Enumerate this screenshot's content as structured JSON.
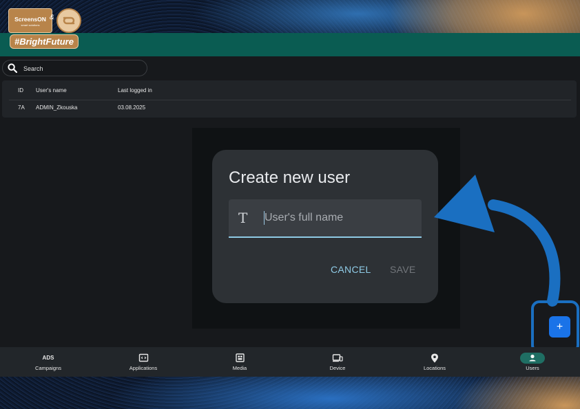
{
  "branding": {
    "brand_name": "ScreensON",
    "brand_sub": "smart solutions",
    "ampersand": "&",
    "hashtag": "#BrightFuture"
  },
  "search": {
    "placeholder": "Search",
    "icon": "search-icon"
  },
  "table": {
    "columns": [
      "ID",
      "User's name",
      "Last logged in"
    ],
    "rows": [
      {
        "id": "7A",
        "name": "ADMIN_Zkouska",
        "last_login": "03.08.2025"
      }
    ]
  },
  "dialog": {
    "title": "Create new user",
    "name_field": {
      "placeholder": "User's full name",
      "value": "",
      "icon": "text-format-icon"
    },
    "cancel_label": "CANCEL",
    "save_label": "SAVE"
  },
  "fab": {
    "label": "+",
    "icon": "add-icon"
  },
  "nav": {
    "items": [
      {
        "label": "Campaigns",
        "icon_text": "ADS",
        "icon": "ads-icon"
      },
      {
        "label": "Applications",
        "icon": "code-window-icon"
      },
      {
        "label": "Media",
        "icon": "media-library-icon"
      },
      {
        "label": "Device",
        "icon": "devices-icon"
      },
      {
        "label": "Locations",
        "icon": "location-pin-icon"
      },
      {
        "label": "Users",
        "icon": "person-icon",
        "active": true
      }
    ]
  },
  "colors": {
    "accent": "#8fcbe6",
    "fab": "#1a73e8",
    "active_pill": "#1f6e63",
    "brand_band": "#0a5c52",
    "annotation": "#1a6fc1"
  }
}
